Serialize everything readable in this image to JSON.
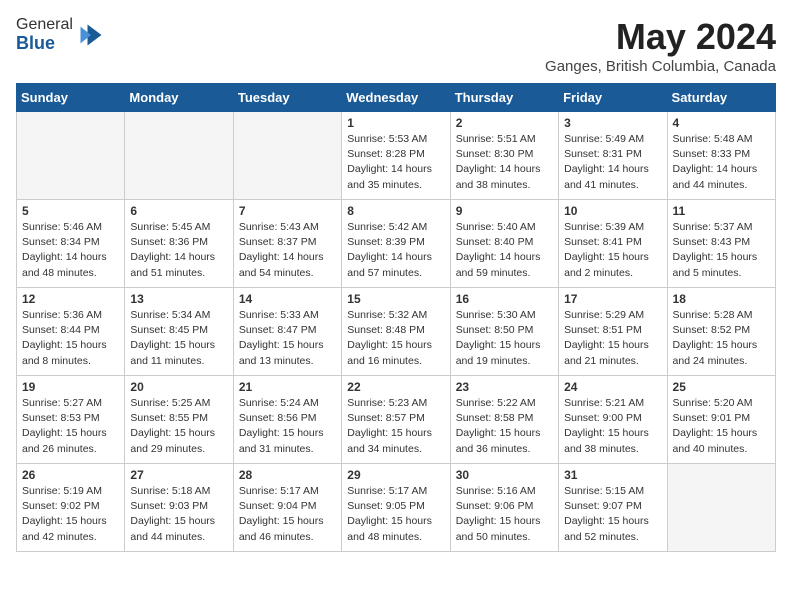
{
  "app": {
    "name_general": "General",
    "name_blue": "Blue"
  },
  "title": "May 2024",
  "location": "Ganges, British Columbia, Canada",
  "days_header": [
    "Sunday",
    "Monday",
    "Tuesday",
    "Wednesday",
    "Thursday",
    "Friday",
    "Saturday"
  ],
  "weeks": [
    [
      {
        "num": "",
        "info": "",
        "empty": true
      },
      {
        "num": "",
        "info": "",
        "empty": true
      },
      {
        "num": "",
        "info": "",
        "empty": true
      },
      {
        "num": "1",
        "info": "Sunrise: 5:53 AM\nSunset: 8:28 PM\nDaylight: 14 hours\nand 35 minutes.",
        "empty": false
      },
      {
        "num": "2",
        "info": "Sunrise: 5:51 AM\nSunset: 8:30 PM\nDaylight: 14 hours\nand 38 minutes.",
        "empty": false
      },
      {
        "num": "3",
        "info": "Sunrise: 5:49 AM\nSunset: 8:31 PM\nDaylight: 14 hours\nand 41 minutes.",
        "empty": false
      },
      {
        "num": "4",
        "info": "Sunrise: 5:48 AM\nSunset: 8:33 PM\nDaylight: 14 hours\nand 44 minutes.",
        "empty": false
      }
    ],
    [
      {
        "num": "5",
        "info": "Sunrise: 5:46 AM\nSunset: 8:34 PM\nDaylight: 14 hours\nand 48 minutes.",
        "empty": false
      },
      {
        "num": "6",
        "info": "Sunrise: 5:45 AM\nSunset: 8:36 PM\nDaylight: 14 hours\nand 51 minutes.",
        "empty": false
      },
      {
        "num": "7",
        "info": "Sunrise: 5:43 AM\nSunset: 8:37 PM\nDaylight: 14 hours\nand 54 minutes.",
        "empty": false
      },
      {
        "num": "8",
        "info": "Sunrise: 5:42 AM\nSunset: 8:39 PM\nDaylight: 14 hours\nand 57 minutes.",
        "empty": false
      },
      {
        "num": "9",
        "info": "Sunrise: 5:40 AM\nSunset: 8:40 PM\nDaylight: 14 hours\nand 59 minutes.",
        "empty": false
      },
      {
        "num": "10",
        "info": "Sunrise: 5:39 AM\nSunset: 8:41 PM\nDaylight: 15 hours\nand 2 minutes.",
        "empty": false
      },
      {
        "num": "11",
        "info": "Sunrise: 5:37 AM\nSunset: 8:43 PM\nDaylight: 15 hours\nand 5 minutes.",
        "empty": false
      }
    ],
    [
      {
        "num": "12",
        "info": "Sunrise: 5:36 AM\nSunset: 8:44 PM\nDaylight: 15 hours\nand 8 minutes.",
        "empty": false
      },
      {
        "num": "13",
        "info": "Sunrise: 5:34 AM\nSunset: 8:45 PM\nDaylight: 15 hours\nand 11 minutes.",
        "empty": false
      },
      {
        "num": "14",
        "info": "Sunrise: 5:33 AM\nSunset: 8:47 PM\nDaylight: 15 hours\nand 13 minutes.",
        "empty": false
      },
      {
        "num": "15",
        "info": "Sunrise: 5:32 AM\nSunset: 8:48 PM\nDaylight: 15 hours\nand 16 minutes.",
        "empty": false
      },
      {
        "num": "16",
        "info": "Sunrise: 5:30 AM\nSunset: 8:50 PM\nDaylight: 15 hours\nand 19 minutes.",
        "empty": false
      },
      {
        "num": "17",
        "info": "Sunrise: 5:29 AM\nSunset: 8:51 PM\nDaylight: 15 hours\nand 21 minutes.",
        "empty": false
      },
      {
        "num": "18",
        "info": "Sunrise: 5:28 AM\nSunset: 8:52 PM\nDaylight: 15 hours\nand 24 minutes.",
        "empty": false
      }
    ],
    [
      {
        "num": "19",
        "info": "Sunrise: 5:27 AM\nSunset: 8:53 PM\nDaylight: 15 hours\nand 26 minutes.",
        "empty": false
      },
      {
        "num": "20",
        "info": "Sunrise: 5:25 AM\nSunset: 8:55 PM\nDaylight: 15 hours\nand 29 minutes.",
        "empty": false
      },
      {
        "num": "21",
        "info": "Sunrise: 5:24 AM\nSunset: 8:56 PM\nDaylight: 15 hours\nand 31 minutes.",
        "empty": false
      },
      {
        "num": "22",
        "info": "Sunrise: 5:23 AM\nSunset: 8:57 PM\nDaylight: 15 hours\nand 34 minutes.",
        "empty": false
      },
      {
        "num": "23",
        "info": "Sunrise: 5:22 AM\nSunset: 8:58 PM\nDaylight: 15 hours\nand 36 minutes.",
        "empty": false
      },
      {
        "num": "24",
        "info": "Sunrise: 5:21 AM\nSunset: 9:00 PM\nDaylight: 15 hours\nand 38 minutes.",
        "empty": false
      },
      {
        "num": "25",
        "info": "Sunrise: 5:20 AM\nSunset: 9:01 PM\nDaylight: 15 hours\nand 40 minutes.",
        "empty": false
      }
    ],
    [
      {
        "num": "26",
        "info": "Sunrise: 5:19 AM\nSunset: 9:02 PM\nDaylight: 15 hours\nand 42 minutes.",
        "empty": false
      },
      {
        "num": "27",
        "info": "Sunrise: 5:18 AM\nSunset: 9:03 PM\nDaylight: 15 hours\nand 44 minutes.",
        "empty": false
      },
      {
        "num": "28",
        "info": "Sunrise: 5:17 AM\nSunset: 9:04 PM\nDaylight: 15 hours\nand 46 minutes.",
        "empty": false
      },
      {
        "num": "29",
        "info": "Sunrise: 5:17 AM\nSunset: 9:05 PM\nDaylight: 15 hours\nand 48 minutes.",
        "empty": false
      },
      {
        "num": "30",
        "info": "Sunrise: 5:16 AM\nSunset: 9:06 PM\nDaylight: 15 hours\nand 50 minutes.",
        "empty": false
      },
      {
        "num": "31",
        "info": "Sunrise: 5:15 AM\nSunset: 9:07 PM\nDaylight: 15 hours\nand 52 minutes.",
        "empty": false
      },
      {
        "num": "",
        "info": "",
        "empty": true
      }
    ]
  ]
}
